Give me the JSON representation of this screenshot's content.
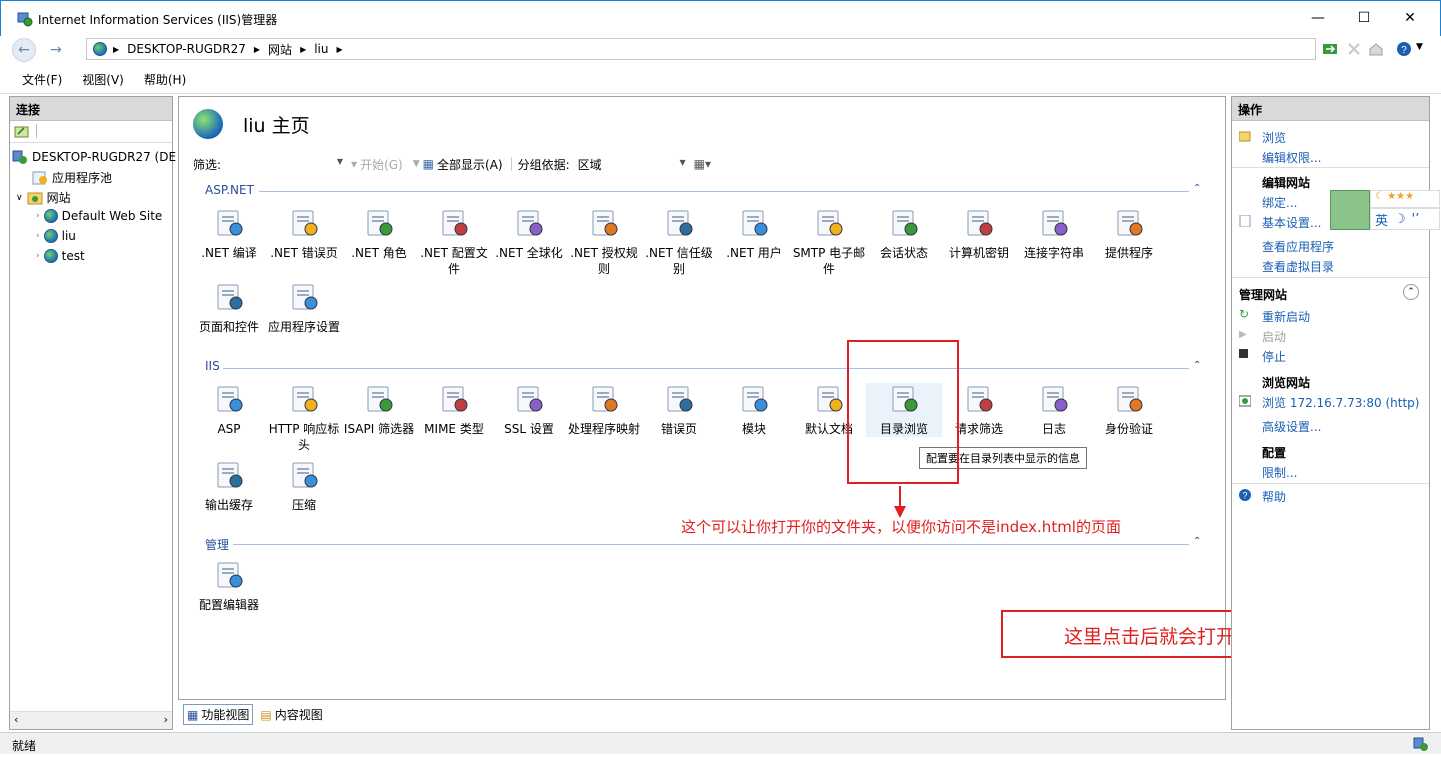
{
  "window": {
    "title": "Internet Information Services (IIS)管理器",
    "minimize": "—",
    "maximize": "☐",
    "close": "✕"
  },
  "address": {
    "crumbs": [
      "DESKTOP-RUGDR27",
      "网站",
      "liu"
    ]
  },
  "menu": {
    "file": "文件(F)",
    "view": "视图(V)",
    "help": "帮助(H)"
  },
  "connections": {
    "header": "连接",
    "server": "DESKTOP-RUGDR27 (DE",
    "app_pools": "应用程序池",
    "sites": "网站",
    "site1": "Default Web Site",
    "site2": "liu",
    "site3": "test"
  },
  "main": {
    "title": "liu 主页",
    "filter_label": "筛选:",
    "start": "开始(G)",
    "show_all": "全部显示(A)",
    "group_by_label": "分组依据:",
    "group_by_value": "区域",
    "groups": {
      "aspnet": "ASP.NET",
      "iis": "IIS",
      "manage": "管理"
    },
    "aspnet_items": [
      ".NET 编译",
      ".NET 错误页",
      ".NET 角色",
      ".NET 配置文件",
      ".NET 全球化",
      ".NET 授权规则",
      ".NET 信任级别",
      ".NET 用户",
      "SMTP 电子邮件",
      "会话状态",
      "计算机密钥",
      "连接字符串",
      "提供程序",
      "页面和控件",
      "应用程序设置"
    ],
    "iis_items": [
      "ASP",
      "HTTP 响应标头",
      "ISAPI 筛选器",
      "MIME 类型",
      "SSL 设置",
      "处理程序映射",
      "错误页",
      "模块",
      "默认文档",
      "目录浏览",
      "请求筛选",
      "日志",
      "身份验证",
      "输出缓存",
      "压缩"
    ],
    "manage_items": [
      "配置编辑器"
    ],
    "tooltip": "配置要在目录列表中显示的信息",
    "annotation": "这个可以让你打开你的文件夹，以便你访问不是index.html的页面"
  },
  "viewtabs": {
    "features": "功能视图",
    "content": "内容视图"
  },
  "actions": {
    "header": "操作",
    "browse": "浏览",
    "edit_perms": "编辑权限...",
    "edit_site": "编辑网站",
    "bindings": "绑定...",
    "basic_settings": "基本设置...",
    "view_apps": "查看应用程序",
    "view_vdirs": "查看虚拟目录",
    "manage_site": "管理网站",
    "restart": "重新启动",
    "start": "启动",
    "stop": "停止",
    "browse_site": "浏览网站",
    "browse_link": "浏览 172.16.7.73:80 (http)",
    "advanced": "高级设置...",
    "config": "配置",
    "limits": "限制...",
    "help": "帮助"
  },
  "ime": {
    "lang": "英"
  },
  "annotation_right": "这里点击后就会打开index.thml",
  "status": "就绪",
  "colors": {
    "accent": "#1a5fb4",
    "annotation": "#e02020",
    "group": "#2a4e9a"
  }
}
